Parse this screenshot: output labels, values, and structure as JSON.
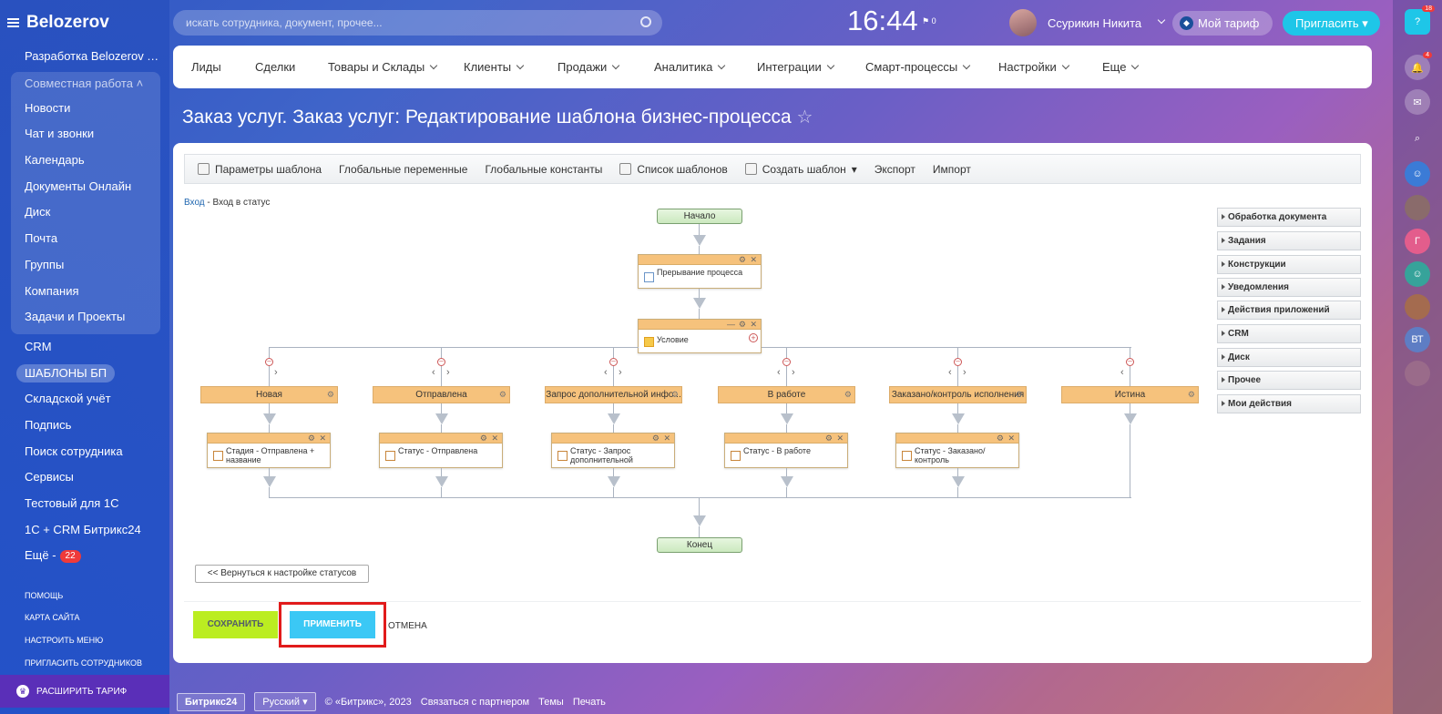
{
  "app": {
    "title": "Belozerov"
  },
  "sidebar": {
    "items_top": [
      "Разработка Belozerov Tea..."
    ],
    "group_title": "Совместная работа",
    "group_items": [
      "Новости",
      "Чат и звонки",
      "Календарь",
      "Документы Онлайн",
      "Диск",
      "Почта",
      "Группы",
      "Компания",
      "Задачи и Проекты"
    ],
    "items": [
      "CRM",
      "ШАБЛОНЫ БП",
      "Складской учёт",
      "Подпись",
      "Поиск сотрудника",
      "Сервисы",
      "Тестовый для 1С",
      "1С + CRM Битрикс24",
      "Ещё -"
    ],
    "more_badge": "22",
    "links": [
      "ПОМОЩЬ",
      "КАРТА САЙТА",
      "НАСТРОИТЬ МЕНЮ",
      "ПРИГЛАСИТЬ СОТРУДНИКОВ"
    ],
    "extend": "РАСШИРИТЬ ТАРИФ"
  },
  "header": {
    "search_placeholder": "искать сотрудника, документ, прочее...",
    "clock": "16:44",
    "flag": "0",
    "user": "Ссурикин Никита",
    "tarif": "Мой тариф",
    "invite": "Пригласить"
  },
  "right_panel": {
    "help_badge": "18",
    "bell_badge": "4",
    "avatar_g": "Г",
    "avatar_bt": "ВТ"
  },
  "topmenu": [
    "Лиды",
    "Сделки",
    "Товары и Склады",
    "Клиенты",
    "Продажи",
    "Аналитика",
    "Интеграции",
    "Смарт-процессы",
    "Настройки",
    "Еще"
  ],
  "page_title": "Заказ услуг. Заказ услуг: Редактирование шаблона бизнес-процесса",
  "toolbar": [
    "Параметры шаблона",
    "Глобальные переменные",
    "Глобальные константы",
    "Список шаблонов",
    "Создать шаблон",
    "Экспорт",
    "Импорт"
  ],
  "breadcrumb": {
    "link": "Вход",
    "rest": " - Вход в статус"
  },
  "diagram": {
    "start": "Начало",
    "end": "Конец",
    "interrupt": "Прерывание процесса",
    "condition": "Условие",
    "branches": [
      "Новая",
      "Отправлена",
      "Запрос дополнительной инфо...",
      "В работе",
      "Заказано/контроль исполнения",
      "Истина"
    ],
    "actions": [
      "Стадия - Отправлена + название",
      "Статус - Отправлена",
      "Статус - Запрос дополнительной",
      "Статус - В работе",
      "Статус - Заказано/контроль"
    ]
  },
  "side_groups": [
    "Обработка документа",
    "Задания",
    "Конструкции",
    "Уведомления",
    "Действия приложений",
    "CRM",
    "Диск",
    "Прочее",
    "Мои действия"
  ],
  "buttons": {
    "back": "<< Вернуться к настройке статусов",
    "save": "СОХРАНИТЬ",
    "apply": "ПРИМЕНИТЬ",
    "cancel": "ОТМЕНА"
  },
  "footer": {
    "brand": "Битрикс24",
    "lang": "Русский",
    "copy": "© «Битрикс», 2023",
    "partner": "Связаться с партнером",
    "themes": "Темы",
    "print": "Печать"
  }
}
